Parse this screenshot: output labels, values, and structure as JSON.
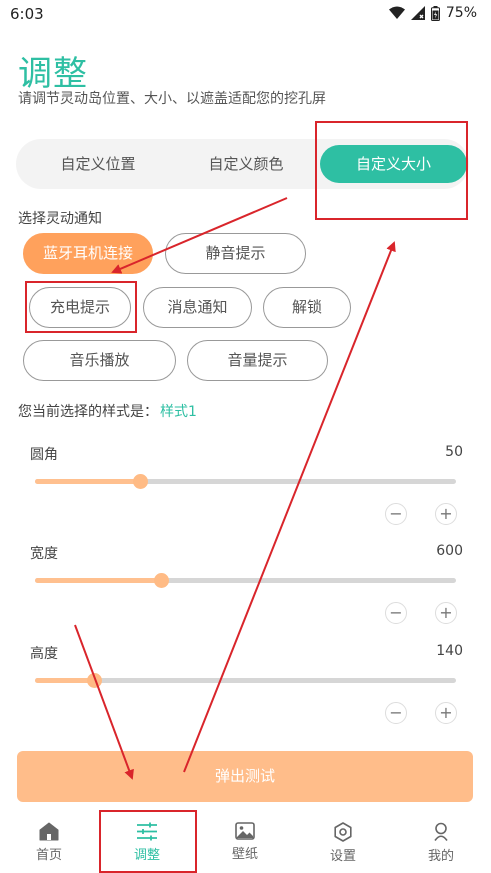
{
  "status": {
    "time": "6:03",
    "battery": "75%"
  },
  "header": {
    "title": "调整",
    "subtitle": "请调节灵动岛位置、大小、以遮盖适配您的挖孔屏"
  },
  "tabs": [
    {
      "label": "自定义位置"
    },
    {
      "label": "自定义颜色"
    },
    {
      "label": "自定义大小",
      "active": true
    }
  ],
  "notifications": {
    "label": "选择灵动通知",
    "chips": [
      {
        "label": "蓝牙耳机连接",
        "selected": true
      },
      {
        "label": "静音提示"
      },
      {
        "label": "充电提示"
      },
      {
        "label": "消息通知"
      },
      {
        "label": "解锁"
      },
      {
        "label": "音乐播放"
      },
      {
        "label": "音量提示"
      }
    ]
  },
  "current_style": {
    "label": "您当前选择的样式是：",
    "value": "样式1"
  },
  "sliders": [
    {
      "label": "圆角",
      "value": "50",
      "level": 0.25
    },
    {
      "label": "宽度",
      "value": "600",
      "level": 0.3
    },
    {
      "label": "高度",
      "value": "140",
      "level": 0.14
    }
  ],
  "stepper": {
    "minus": "−",
    "plus": "+"
  },
  "popup_button": {
    "label": "弹出测试"
  },
  "bottom_nav": [
    {
      "label": "首页",
      "icon": "home-icon"
    },
    {
      "label": "调整",
      "icon": "sliders-icon",
      "active": true
    },
    {
      "label": "壁纸",
      "icon": "image-icon"
    },
    {
      "label": "设置",
      "icon": "gear-icon"
    },
    {
      "label": "我的",
      "icon": "person-icon"
    }
  ],
  "colors": {
    "accent": "#2ebfa3",
    "orange": "#ffa15c",
    "annotation": "#d9252b"
  }
}
